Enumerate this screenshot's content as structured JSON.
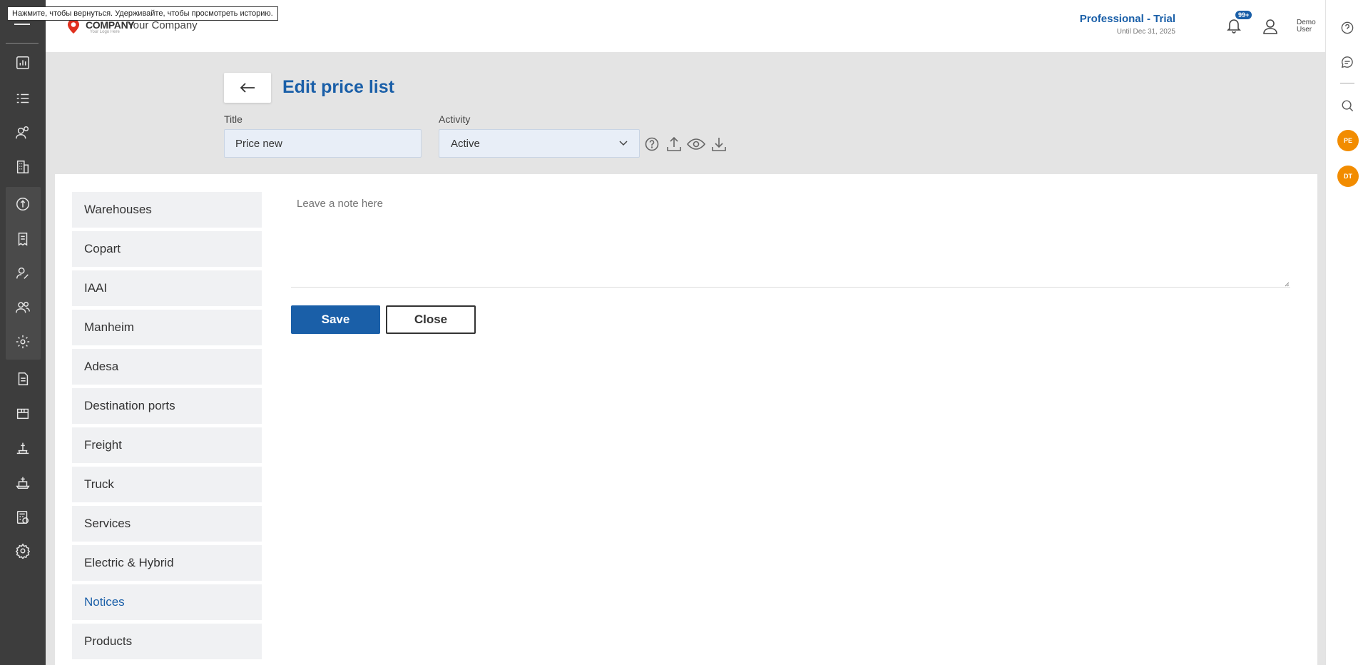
{
  "tooltip": "Нажмите, чтобы вернуться. Удерживайте, чтобы просмотреть историю.",
  "header": {
    "logo_word": "COMPANY",
    "logo_sub": "Your Logo Here",
    "company_name": "Your Company",
    "plan_title": "Professional - Trial",
    "plan_sub": "Until Dec 31, 2025",
    "notification_badge": "99+",
    "user_name": "Demo User"
  },
  "sidebar": {
    "icons": [
      "menu-icon",
      "dashboard-chart-icon",
      "checklist-icon",
      "contacts-icon",
      "buildings-icon",
      "exchange-icon",
      "receipt-icon",
      "user-edit-icon",
      "users-icon",
      "gear-dollar-icon",
      "document-icon",
      "package-icon",
      "ship-port-icon",
      "ship-icon",
      "calculator-icon",
      "settings-icon"
    ]
  },
  "page": {
    "title": "Edit price list",
    "title_label": "Title",
    "title_value": "Price new",
    "activity_label": "Activity",
    "activity_value": "Active"
  },
  "categories": [
    {
      "label": "Warehouses",
      "active": false
    },
    {
      "label": "Copart",
      "active": false
    },
    {
      "label": "IAAI",
      "active": false
    },
    {
      "label": "Manheim",
      "active": false
    },
    {
      "label": "Adesa",
      "active": false
    },
    {
      "label": "Destination ports",
      "active": false
    },
    {
      "label": "Freight",
      "active": false
    },
    {
      "label": "Truck",
      "active": false
    },
    {
      "label": "Services",
      "active": false
    },
    {
      "label": "Electric & Hybrid",
      "active": false
    },
    {
      "label": "Notices",
      "active": true
    },
    {
      "label": "Products",
      "active": false
    }
  ],
  "note": {
    "placeholder": "Leave a note here",
    "value": ""
  },
  "actions": {
    "save_label": "Save",
    "close_label": "Close"
  },
  "right_rail": {
    "avatars": [
      "PE",
      "DT"
    ]
  },
  "colors": {
    "accent": "#1a5fa8",
    "sidebar_bg": "#3d3d3d",
    "avatar": "#f28c00"
  }
}
